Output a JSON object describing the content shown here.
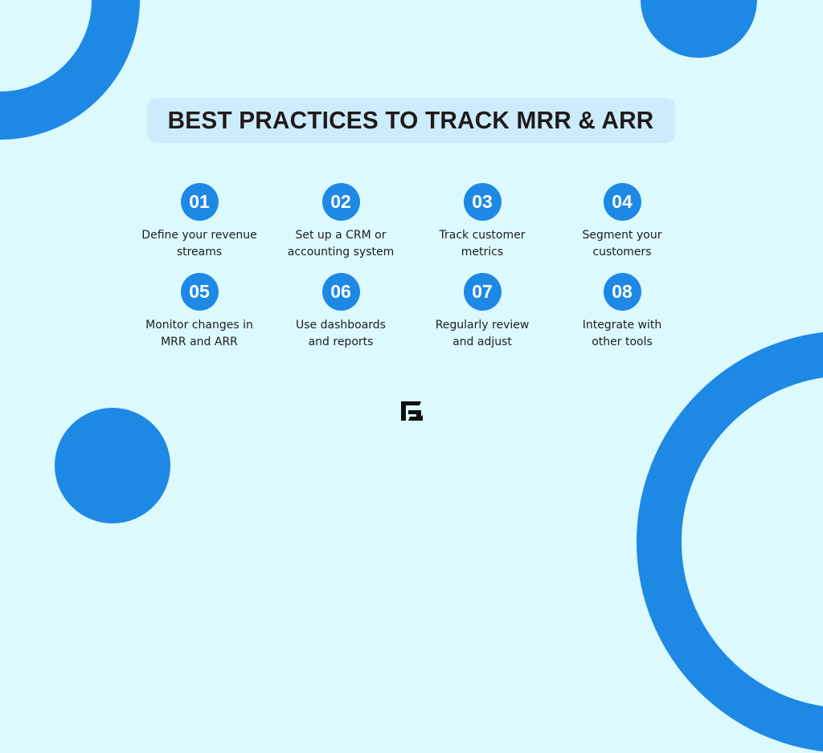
{
  "title": "BEST PRACTICES TO TRACK MRR & ARR",
  "colors": {
    "background": "#dcf9fd",
    "accent": "#1e88e5",
    "title_box": "#cbedfb",
    "title_text": "#22191a"
  },
  "items": [
    {
      "number": "01",
      "line1": "Define your revenue",
      "line2": "streams"
    },
    {
      "number": "02",
      "line1": "Set up a CRM or",
      "line2": "accounting system"
    },
    {
      "number": "03",
      "line1": "Track customer",
      "line2": "metrics"
    },
    {
      "number": "04",
      "line1": "Segment your",
      "line2": "customers"
    },
    {
      "number": "05",
      "line1": "Monitor changes in",
      "line2": "MRR and ARR"
    },
    {
      "number": "06",
      "line1": "Use dashboards",
      "line2": "and reports"
    },
    {
      "number": "07",
      "line1": "Regularly review",
      "line2": "and adjust"
    },
    {
      "number": "08",
      "line1": "Integrate with",
      "line2": "other tools"
    }
  ],
  "logo": {
    "icon": "g-logo-icon"
  }
}
